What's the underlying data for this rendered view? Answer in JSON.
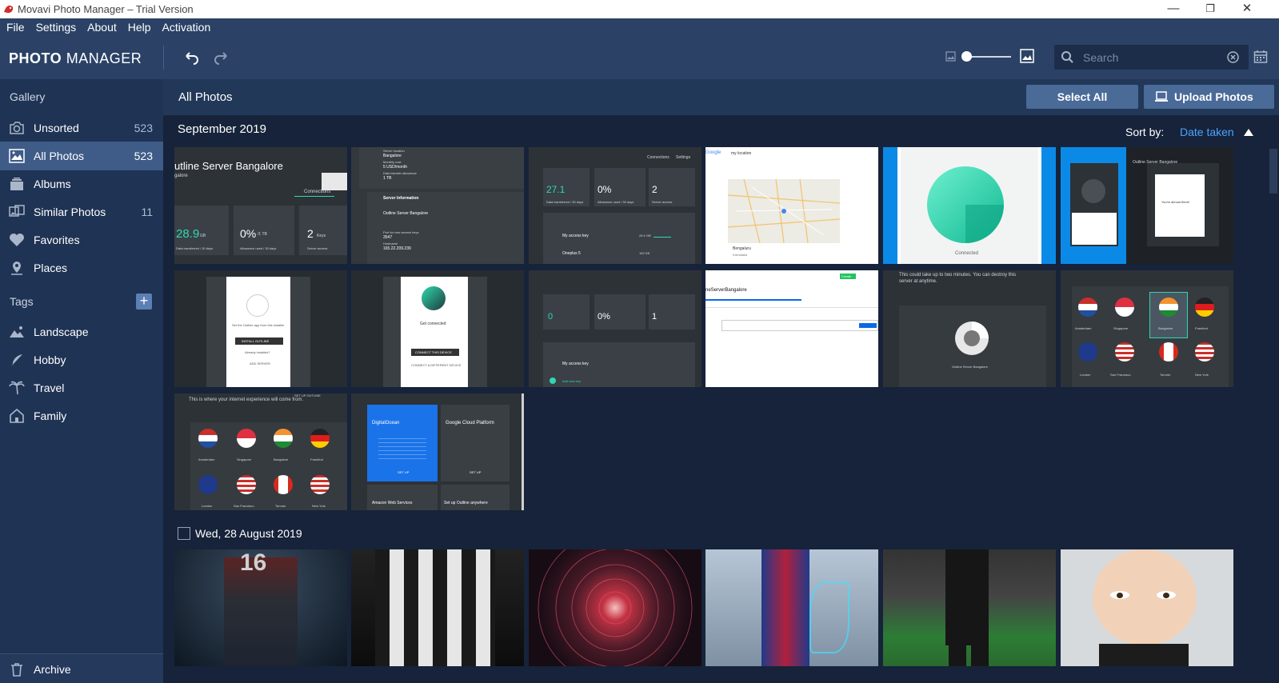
{
  "window": {
    "title": "Movavi Photo Manager – Trial Version",
    "minimize": "—",
    "maximize": "❐",
    "close": "✕"
  },
  "menu": [
    "File",
    "Settings",
    "About",
    "Help",
    "Activation"
  ],
  "toolbar": {
    "logo_bold": "PHOTO",
    "logo_light": "MANAGER",
    "search_placeholder": "Search"
  },
  "sidebar": {
    "gallery_label": "Gallery",
    "items": [
      {
        "label": "Unsorted",
        "count": "523",
        "icon": "camera-icon"
      },
      {
        "label": "All Photos",
        "count": "523",
        "icon": "photos-icon",
        "active": true
      },
      {
        "label": "Albums",
        "count": "",
        "icon": "albums-icon"
      },
      {
        "label": "Similar Photos",
        "count": "11",
        "icon": "similar-icon"
      },
      {
        "label": "Favorites",
        "count": "",
        "icon": "heart-icon"
      },
      {
        "label": "Places",
        "count": "",
        "icon": "pin-icon"
      }
    ],
    "tags_label": "Tags",
    "add_tag": "+",
    "tags": [
      {
        "label": "Landscape",
        "icon": "landscape-icon"
      },
      {
        "label": "Hobby",
        "icon": "feather-icon"
      },
      {
        "label": "Travel",
        "icon": "palm-icon"
      },
      {
        "label": "Family",
        "icon": "house-icon"
      }
    ],
    "archive_label": "Archive"
  },
  "main": {
    "title": "All Photos",
    "select_all": "Select All",
    "upload": "Upload Photos",
    "sort_label": "Sort by:",
    "sort_value": "Date taken",
    "groups": [
      {
        "title": "September 2019"
      },
      {
        "title": "Wed, 28 August 2019"
      }
    ]
  },
  "thumbs": {
    "t1": {
      "title": "utline Server Bangalore",
      "sub": "galore",
      "tab": "Connections",
      "v1": "28.9",
      "v1u": "GB",
      "v1l": "Data transferred / 30 days",
      "v2": "0%",
      "v2u": "/1 TB",
      "v2l": "Allowance used / 30 days",
      "v3": "2",
      "v3u": "Keys",
      "v3l": "Server access"
    },
    "t2": {
      "a": "Server location",
      "b": "Bangalore",
      "c": "Monthly cost",
      "d": "5 USD/month",
      "e": "Data transfer allowance",
      "f": "1 TB",
      "g": "Server Information",
      "h": "Outline Server Bangalore",
      "i": "Port for new access keys",
      "j": "3547",
      "k": "Hostname",
      "l": "165.22.209.239"
    },
    "t3": {
      "tab1": "Connections",
      "tab2": "Settings",
      "v1": "27.1",
      "v2": "0%",
      "v3": "2",
      "l1": "Data transferred / 30 days",
      "l2": "Allowance used / 30 days",
      "l3": "Server access",
      "k1": "My access key",
      "k2": "Oneplus 5",
      "s1": "26.9 GB",
      "s2": "162 KB"
    },
    "t4": {
      "logo": "Google",
      "query": "my location",
      "city": "Bengaluru",
      "state": "Karnataka"
    },
    "t5": {
      "caption": "Connected"
    },
    "t6": {
      "title": "Outline Server Bangalore",
      "msg": "You're almost there!"
    },
    "t7": {
      "a": "Set the Outline app from this installer",
      "btn": "INSTALL OUTLINE",
      "b": "Already installed?",
      "c": "ADD SERVER"
    },
    "t8": {
      "a": "Get connected",
      "btn": "CONNECT THIS DEVICE",
      "c": "CONNECT A DIFFERENT DEVICE"
    },
    "t9": {
      "v1": "0",
      "v2": "0%",
      "v3": "1",
      "k1": "My access key",
      "k2": "Add new key"
    },
    "t10": {
      "title": "neServerBangalore",
      "btn": "Create"
    },
    "t11": {
      "a": "This could take up to two minutes. You can destroy this server at anytime.",
      "b": "Outline Server Bangalore"
    },
    "t12": {
      "cities": [
        "Amsterdam",
        "Singapore",
        "Bangalore",
        "Frankfurt",
        "London",
        "San Francisco",
        "Toronto",
        "New York"
      ]
    },
    "t13": {
      "a": "This is where your internet experience will come from.",
      "b": "SET UP OUTLINE",
      "cities": [
        "Amsterdam",
        "Singapore",
        "Bangalore",
        "Frankfurt",
        "London",
        "San Francisco",
        "Toronto",
        "New York"
      ]
    },
    "t14": {
      "a": "DigitalOcean",
      "b": "Google Cloud Platform",
      "c": "SET UP",
      "d": "SET UP",
      "e": "Amazon Web Services",
      "f": "Set up Outline anywhere"
    },
    "p1": {
      "num": "16"
    }
  },
  "colors": {
    "accent": "#4aa3ff",
    "sidebar_active": "#3f5c88",
    "selection": "#1aa0f0"
  }
}
